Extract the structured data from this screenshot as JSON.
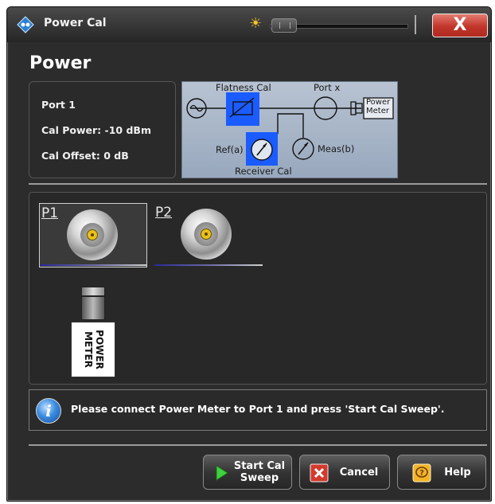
{
  "window": {
    "title": "Power Cal",
    "close_label": "X"
  },
  "page": {
    "heading": "Power"
  },
  "info": {
    "port": "Port 1",
    "cal_power": "Cal Power: -10 dBm",
    "cal_offset": "Cal Offset: 0 dB"
  },
  "diagram": {
    "flatness_cal": "Flatness Cal",
    "port_x": "Port x",
    "power_meter_line1": "Power",
    "power_meter_line2": "Meter",
    "ref": "Ref(a)",
    "meas": "Meas(b)",
    "receiver_cal": "Receiver Cal"
  },
  "ports": [
    {
      "label": "P1",
      "selected": true
    },
    {
      "label": "P2",
      "selected": false
    }
  ],
  "power_meter": {
    "line1": "POWER",
    "line2": "METER"
  },
  "message": "Please connect Power Meter to Port 1 and press 'Start Cal Sweep'.",
  "buttons": {
    "start_line1": "Start Cal",
    "start_line2": "Sweep",
    "cancel": "Cancel",
    "help": "Help"
  },
  "colors": {
    "highlight_blue": "#1a5cff",
    "close_red": "#c2352a",
    "port_pin": "#e8c11a"
  }
}
